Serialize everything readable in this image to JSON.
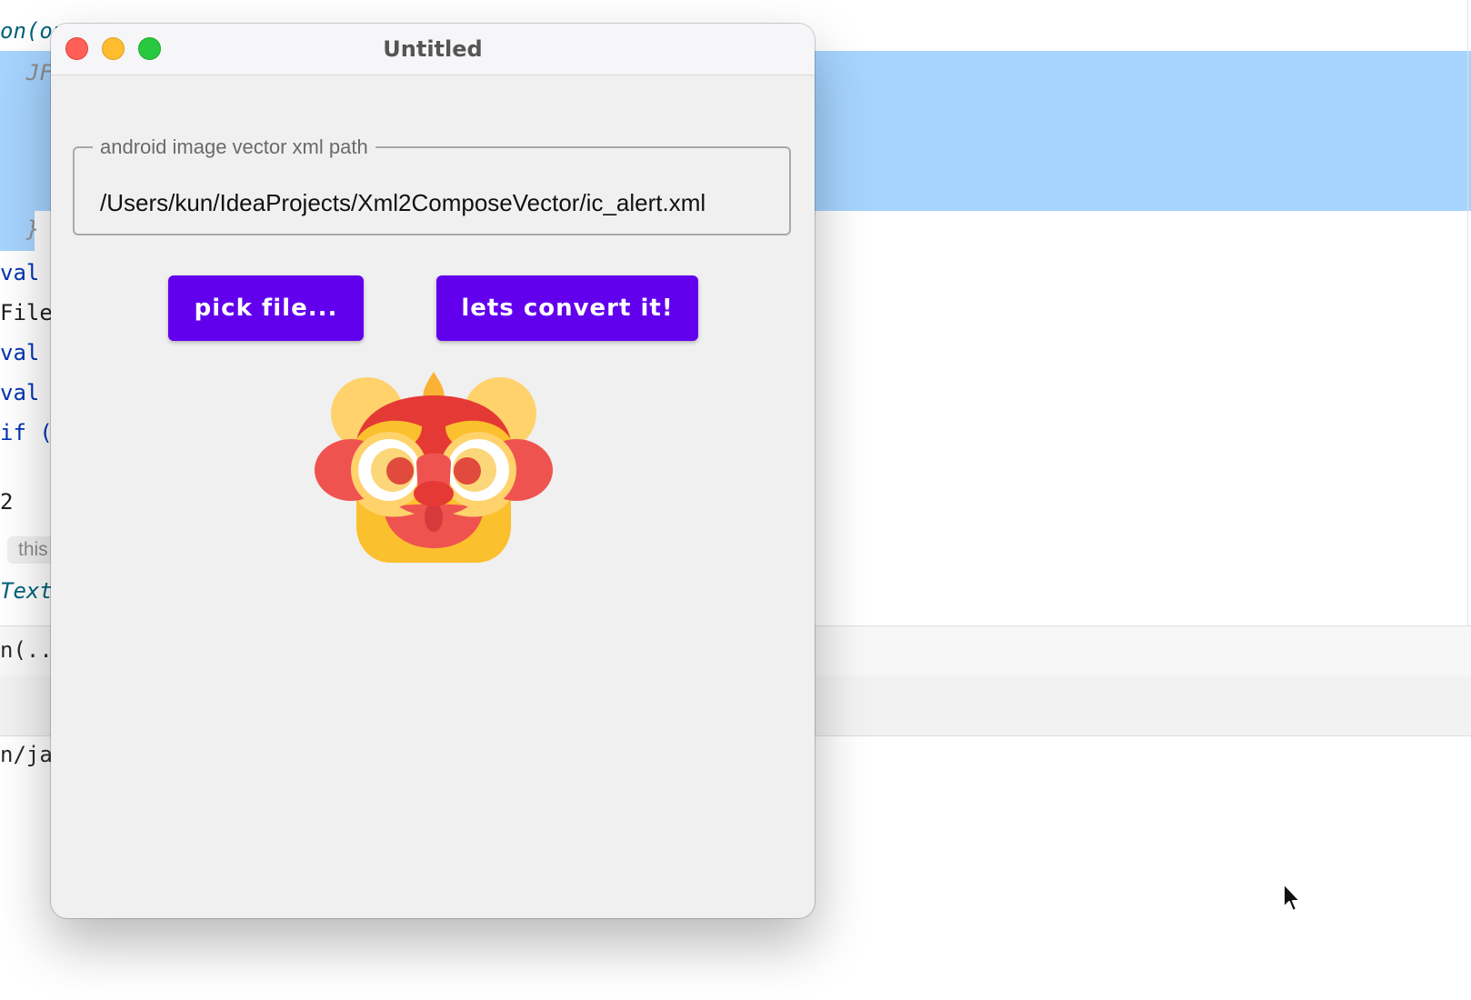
{
  "ide": {
    "code_lines": [
      {
        "text": "on(on",
        "kind": "fn"
      },
      {
        "text": "  JF",
        "kind": "comment"
      },
      {
        "text": "  }",
        "kind": "comment"
      },
      {
        "text": "val ",
        "kind": "kw"
      },
      {
        "text": "File",
        "kind": "plain"
      },
      {
        "text": "val ",
        "kind": "kw"
      },
      {
        "text": "val ",
        "kind": "kw"
      },
      {
        "text": "if (",
        "kind": "kw"
      },
      {
        "text": "2",
        "kind": "plain"
      },
      {
        "text": "Text",
        "kind": "fn"
      }
    ],
    "hint_chip": "this",
    "panel_label_1": "n(...",
    "panel_label_2": "n/ja"
  },
  "window": {
    "title": "Untitled",
    "path_field": {
      "label": "android image vector xml path",
      "value": "/Users/kun/IdeaProjects/Xml2ComposeVector/ic_alert.xml"
    },
    "buttons": {
      "pick_label": "pick file...",
      "convert_label": "lets convert it!"
    },
    "preview": {
      "icon_name": "lion-dance-icon"
    }
  },
  "colors": {
    "accent": "#6200ee",
    "selection": "#a6d4ff",
    "close": "#ff5f57",
    "minimize": "#febc2e",
    "maximize": "#28c840"
  }
}
